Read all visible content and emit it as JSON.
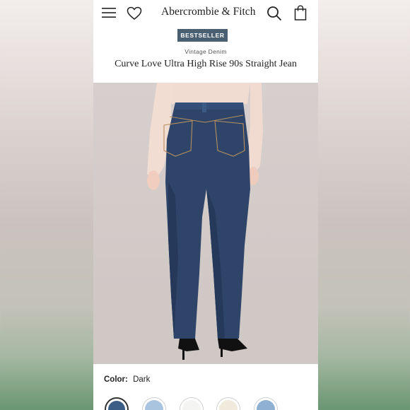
{
  "brand": {
    "logo_text": "Abercrombie & Fitch"
  },
  "header": {
    "icons": [
      "menu-icon",
      "heart-icon",
      "search-icon",
      "shopping-bag-icon"
    ]
  },
  "product": {
    "badge": "BESTSELLER",
    "category": "Vintage Denim",
    "title": "Curve Love Ultra High Rise 90s Straight Jean"
  },
  "color": {
    "label": "Color:",
    "selected_value": "Dark",
    "swatches": [
      {
        "name": "Dark",
        "hex": "#3b5d86",
        "selected": true
      },
      {
        "name": "Light Blue",
        "hex": "#a9c4df",
        "selected": false
      },
      {
        "name": "White",
        "hex": "#f4f4f2",
        "selected": false
      },
      {
        "name": "Cream",
        "hex": "#efeadc",
        "selected": false
      },
      {
        "name": "Medium Blue",
        "hex": "#8fb0d1",
        "selected": false
      }
    ]
  },
  "colors": {
    "badge_bg": "#4b5f72",
    "denim": "#2e4468",
    "background": "#ffffff"
  }
}
